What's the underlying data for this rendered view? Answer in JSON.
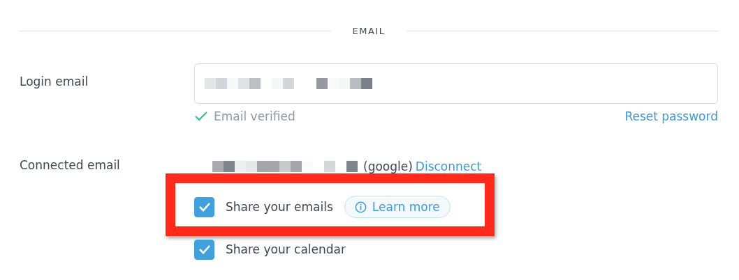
{
  "section": {
    "title": "EMAIL"
  },
  "login": {
    "label": "Login email",
    "verified": {
      "text": "Email verified"
    },
    "reset_link": "Reset password"
  },
  "connected": {
    "label": "Connected email",
    "provider": "(google)",
    "disconnect_link": "Disconnect"
  },
  "options": [
    {
      "label": "Share your emails",
      "checked": true,
      "highlighted": true,
      "learn_more": "Learn more"
    },
    {
      "label": "Share your calendar",
      "checked": true,
      "highlighted": false
    }
  ]
}
